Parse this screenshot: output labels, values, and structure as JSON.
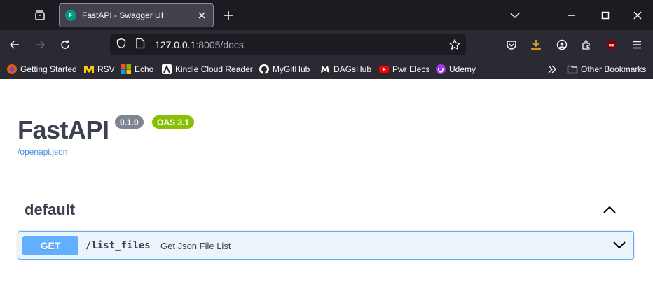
{
  "browser": {
    "tab": {
      "title": "FastAPI - Swagger UI",
      "favicon_letter": "F"
    },
    "url": {
      "host": "127.0.0.1",
      "rest": ":8005/docs"
    },
    "bookmarks": [
      {
        "label": "Getting Started",
        "icon": "firefox-icon",
        "color": "#e66000"
      },
      {
        "label": "RSV",
        "icon": "michigan-m-icon",
        "color": "#ffcb05"
      },
      {
        "label": "Echo",
        "icon": "microsoft-icon",
        "color": "#f25022"
      },
      {
        "label": "Kindle Cloud Reader",
        "icon": "kindle-icon",
        "color": "#ffffff"
      },
      {
        "label": "MyGitHub",
        "icon": "github-icon",
        "color": "#ffffff"
      },
      {
        "label": "DAGsHub",
        "icon": "dagshub-icon",
        "color": "#ffffff"
      },
      {
        "label": "Pwr Elecs",
        "icon": "youtube-icon",
        "color": "#ff0000"
      },
      {
        "label": "Udemy",
        "icon": "udemy-icon",
        "color": "#a435f0"
      }
    ],
    "other_bookmarks": "Other Bookmarks",
    "extension_badge": "uo"
  },
  "swagger": {
    "title": "FastAPI",
    "version_badge": "0.1.0",
    "oas_badge": "OAS 3.1",
    "spec_link": "/openapi.json",
    "tag": {
      "name": "default"
    },
    "operations": [
      {
        "method": "GET",
        "path": "/list_files",
        "summary": "Get Json File List"
      }
    ]
  },
  "colors": {
    "get_method": "#61affe",
    "get_bg": "#ebf3fb",
    "oas_badge": "#89bf04",
    "version_badge": "#7d8492",
    "link": "#4990e2"
  }
}
